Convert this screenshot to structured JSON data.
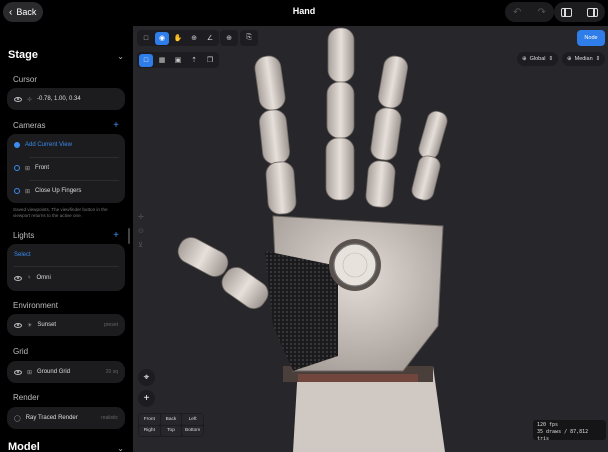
{
  "header": {
    "back_label": "Back",
    "title": "Hand",
    "icons": [
      "chevron-left-icon",
      "undo-icon",
      "redo-icon",
      "left-panel-icon",
      "right-panel-icon"
    ]
  },
  "sidebar": {
    "stage_title": "Stage",
    "cursor": {
      "label": "Cursor",
      "value": "-0.78, 1.00, 0.34"
    },
    "cameras": {
      "label": "Cameras",
      "add_label": "Add Current View",
      "items": [
        "Front",
        "Close Up Fingers"
      ],
      "note": "Saved viewpoints. The viewfinder button in the viewport returns to the active one."
    },
    "lights": {
      "label": "Lights",
      "select_label": "Select",
      "items": [
        "Omni"
      ]
    },
    "environment": {
      "label": "Environment",
      "value": "Sunset",
      "trail": "preset"
    },
    "grid": {
      "label": "Grid",
      "value": "Ground Grid",
      "trail": "20 sq"
    },
    "render": {
      "label": "Render",
      "value": "Ray Traced Render",
      "trail": "realistic"
    },
    "model_title": "Model"
  },
  "viewport": {
    "node_button": "Node",
    "dropdowns": {
      "space": "Global",
      "pivot": "Median"
    },
    "views": [
      "Front",
      "Back",
      "Left",
      "Right",
      "Top",
      "Bottom"
    ],
    "stats": {
      "fps": "120 fps",
      "draws": "35 draws / 87,812 tris"
    }
  },
  "colors": {
    "accent": "#2f7de8",
    "panel": "#1c1c1e",
    "viewport_bg": "#27272b"
  }
}
